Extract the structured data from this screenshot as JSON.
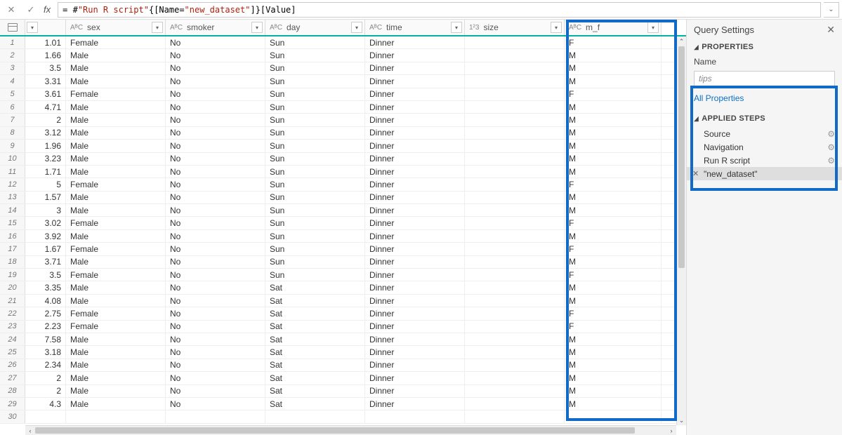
{
  "formula": {
    "prefix": "= #",
    "q1": "\"Run R script\"",
    "mid1": "{[Name=",
    "q2": "\"new_dataset\"",
    "mid2": "]}[Value]"
  },
  "columns": {
    "sex": "sex",
    "smoker": "smoker",
    "day": "day",
    "time": "time",
    "size": "size",
    "m_f": "m_f"
  },
  "types": {
    "abc": "AᴮC",
    "num": "1²3"
  },
  "rows": [
    {
      "n": "1",
      "tip": "1.01",
      "sex": "Female",
      "smoker": "No",
      "day": "Sun",
      "time": "Dinner",
      "size": "",
      "mf": "F"
    },
    {
      "n": "2",
      "tip": "1.66",
      "sex": "Male",
      "smoker": "No",
      "day": "Sun",
      "time": "Dinner",
      "size": "",
      "mf": "M"
    },
    {
      "n": "3",
      "tip": "3.5",
      "sex": "Male",
      "smoker": "No",
      "day": "Sun",
      "time": "Dinner",
      "size": "",
      "mf": "M"
    },
    {
      "n": "4",
      "tip": "3.31",
      "sex": "Male",
      "smoker": "No",
      "day": "Sun",
      "time": "Dinner",
      "size": "",
      "mf": "M"
    },
    {
      "n": "5",
      "tip": "3.61",
      "sex": "Female",
      "smoker": "No",
      "day": "Sun",
      "time": "Dinner",
      "size": "",
      "mf": "F"
    },
    {
      "n": "6",
      "tip": "4.71",
      "sex": "Male",
      "smoker": "No",
      "day": "Sun",
      "time": "Dinner",
      "size": "",
      "mf": "M"
    },
    {
      "n": "7",
      "tip": "2",
      "sex": "Male",
      "smoker": "No",
      "day": "Sun",
      "time": "Dinner",
      "size": "",
      "mf": "M"
    },
    {
      "n": "8",
      "tip": "3.12",
      "sex": "Male",
      "smoker": "No",
      "day": "Sun",
      "time": "Dinner",
      "size": "",
      "mf": "M"
    },
    {
      "n": "9",
      "tip": "1.96",
      "sex": "Male",
      "smoker": "No",
      "day": "Sun",
      "time": "Dinner",
      "size": "",
      "mf": "M"
    },
    {
      "n": "10",
      "tip": "3.23",
      "sex": "Male",
      "smoker": "No",
      "day": "Sun",
      "time": "Dinner",
      "size": "",
      "mf": "M"
    },
    {
      "n": "11",
      "tip": "1.71",
      "sex": "Male",
      "smoker": "No",
      "day": "Sun",
      "time": "Dinner",
      "size": "",
      "mf": "M"
    },
    {
      "n": "12",
      "tip": "5",
      "sex": "Female",
      "smoker": "No",
      "day": "Sun",
      "time": "Dinner",
      "size": "",
      "mf": "F"
    },
    {
      "n": "13",
      "tip": "1.57",
      "sex": "Male",
      "smoker": "No",
      "day": "Sun",
      "time": "Dinner",
      "size": "",
      "mf": "M"
    },
    {
      "n": "14",
      "tip": "3",
      "sex": "Male",
      "smoker": "No",
      "day": "Sun",
      "time": "Dinner",
      "size": "",
      "mf": "M"
    },
    {
      "n": "15",
      "tip": "3.02",
      "sex": "Female",
      "smoker": "No",
      "day": "Sun",
      "time": "Dinner",
      "size": "",
      "mf": "F"
    },
    {
      "n": "16",
      "tip": "3.92",
      "sex": "Male",
      "smoker": "No",
      "day": "Sun",
      "time": "Dinner",
      "size": "",
      "mf": "M"
    },
    {
      "n": "17",
      "tip": "1.67",
      "sex": "Female",
      "smoker": "No",
      "day": "Sun",
      "time": "Dinner",
      "size": "",
      "mf": "F"
    },
    {
      "n": "18",
      "tip": "3.71",
      "sex": "Male",
      "smoker": "No",
      "day": "Sun",
      "time": "Dinner",
      "size": "",
      "mf": "M"
    },
    {
      "n": "19",
      "tip": "3.5",
      "sex": "Female",
      "smoker": "No",
      "day": "Sun",
      "time": "Dinner",
      "size": "",
      "mf": "F"
    },
    {
      "n": "20",
      "tip": "3.35",
      "sex": "Male",
      "smoker": "No",
      "day": "Sat",
      "time": "Dinner",
      "size": "",
      "mf": "M"
    },
    {
      "n": "21",
      "tip": "4.08",
      "sex": "Male",
      "smoker": "No",
      "day": "Sat",
      "time": "Dinner",
      "size": "",
      "mf": "M"
    },
    {
      "n": "22",
      "tip": "2.75",
      "sex": "Female",
      "smoker": "No",
      "day": "Sat",
      "time": "Dinner",
      "size": "",
      "mf": "F"
    },
    {
      "n": "23",
      "tip": "2.23",
      "sex": "Female",
      "smoker": "No",
      "day": "Sat",
      "time": "Dinner",
      "size": "",
      "mf": "F"
    },
    {
      "n": "24",
      "tip": "7.58",
      "sex": "Male",
      "smoker": "No",
      "day": "Sat",
      "time": "Dinner",
      "size": "",
      "mf": "M"
    },
    {
      "n": "25",
      "tip": "3.18",
      "sex": "Male",
      "smoker": "No",
      "day": "Sat",
      "time": "Dinner",
      "size": "",
      "mf": "M"
    },
    {
      "n": "26",
      "tip": "2.34",
      "sex": "Male",
      "smoker": "No",
      "day": "Sat",
      "time": "Dinner",
      "size": "",
      "mf": "M"
    },
    {
      "n": "27",
      "tip": "2",
      "sex": "Male",
      "smoker": "No",
      "day": "Sat",
      "time": "Dinner",
      "size": "",
      "mf": "M"
    },
    {
      "n": "28",
      "tip": "2",
      "sex": "Male",
      "smoker": "No",
      "day": "Sat",
      "time": "Dinner",
      "size": "",
      "mf": "M"
    },
    {
      "n": "29",
      "tip": "4.3",
      "sex": "Male",
      "smoker": "No",
      "day": "Sat",
      "time": "Dinner",
      "size": "",
      "mf": "M"
    },
    {
      "n": "30",
      "tip": "",
      "sex": "",
      "smoker": "",
      "day": "",
      "time": "",
      "size": "",
      "mf": ""
    }
  ],
  "side": {
    "title": "Query Settings",
    "properties": "PROPERTIES",
    "name_label": "Name",
    "name_value": "tips",
    "all_props": "All Properties",
    "applied": "APPLIED STEPS",
    "steps": {
      "source": "Source",
      "navigation": "Navigation",
      "run_r": "Run R script",
      "new_dataset": "\"new_dataset\""
    }
  }
}
